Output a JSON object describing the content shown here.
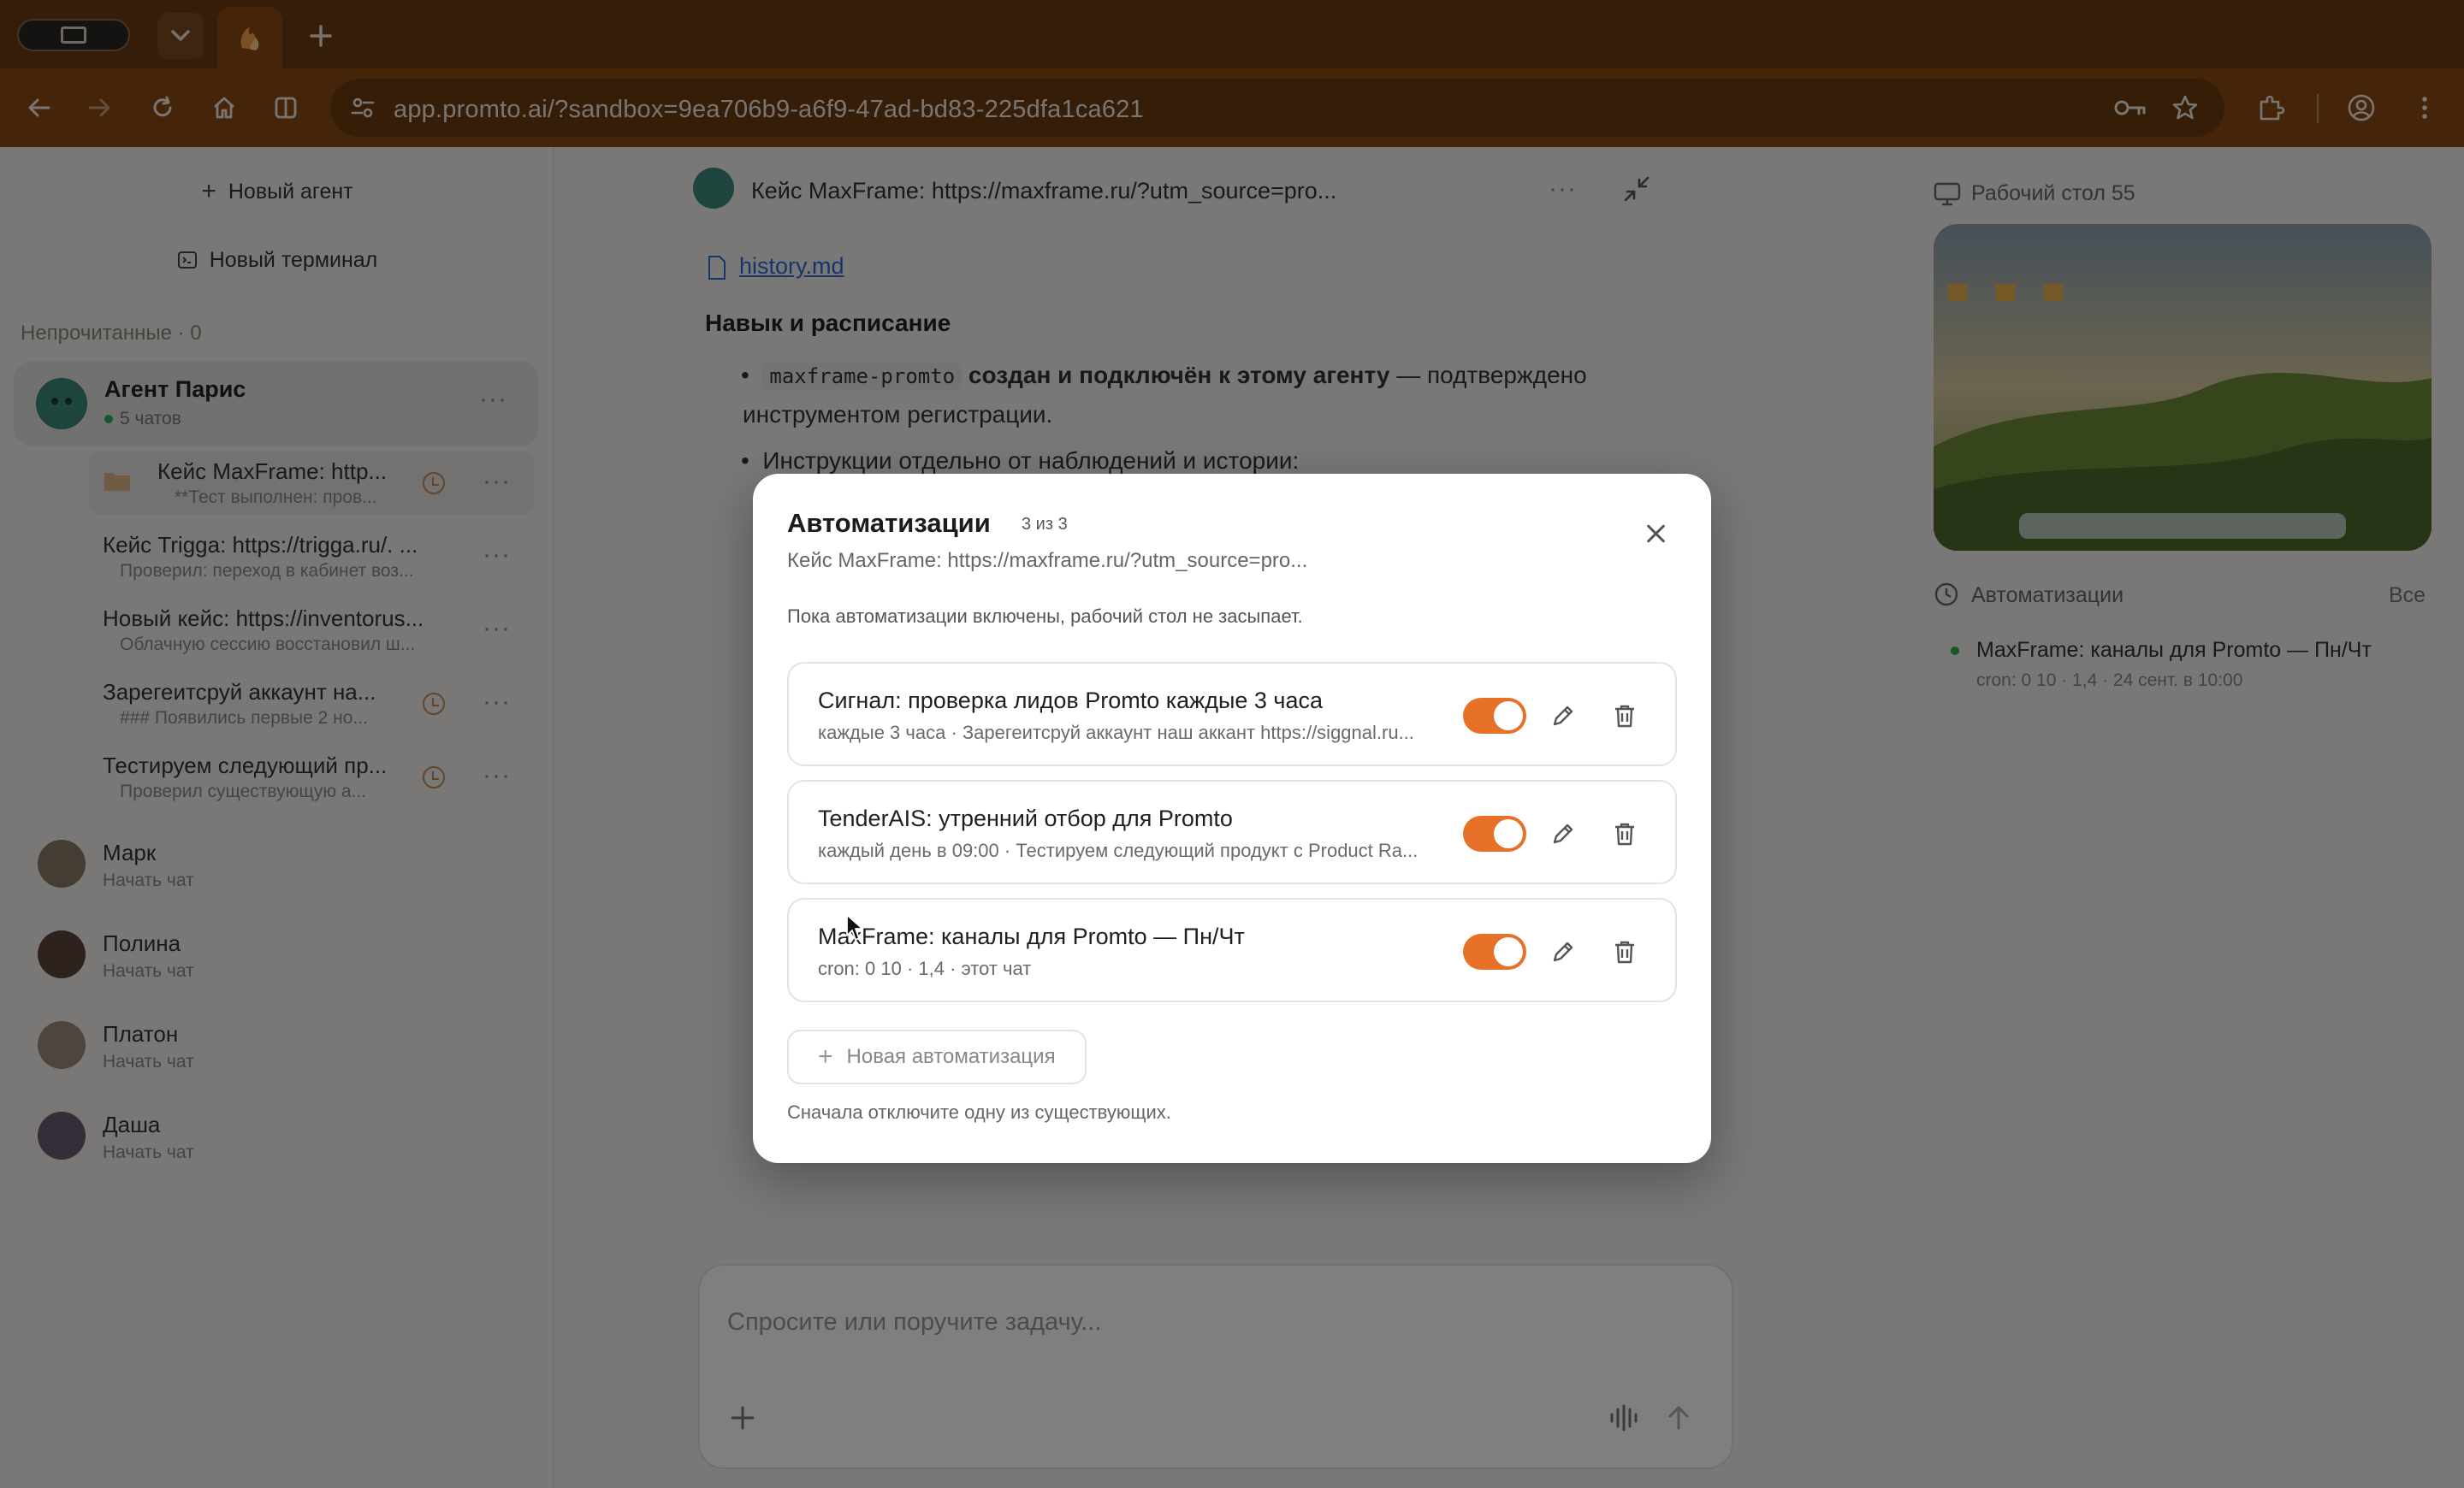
{
  "browser": {
    "url": "app.promto.ai/?sandbox=9ea706b9-a6f9-47ad-bd83-225dfa1ca621"
  },
  "sidebar": {
    "new_agent": "Новый агент",
    "new_terminal": "Новый терминал",
    "section_unread": "Непрочитанные · 0",
    "agent": {
      "name": "Агент Парис",
      "sub": "5 чатов"
    },
    "chats": [
      {
        "title": "Кейс MaxFrame: http...",
        "sub": "**Тест выполнен: пров..."
      },
      {
        "title": "Кейс Trigga: https://trigga.ru/. ...",
        "sub": "Проверил: переход в кабинет воз..."
      },
      {
        "title": "Новый кейс: https://inventorus...",
        "sub": "Облачную сессию восстановил ш..."
      },
      {
        "title": "Зарегеитсруй аккаунт на...",
        "sub": "### Появились первые 2 но..."
      },
      {
        "title": "Тестируем следующий пр...",
        "sub": "Проверил существующую а..."
      }
    ],
    "people": [
      {
        "name": "Марк",
        "sub": "Начать чат"
      },
      {
        "name": "Полина",
        "sub": "Начать чат"
      },
      {
        "name": "Платон",
        "sub": "Начать чат"
      },
      {
        "name": "Даша",
        "sub": "Начать чат"
      }
    ]
  },
  "chat": {
    "title": "Кейс MaxFrame: https://maxframe.ru/?utm_source=pro...",
    "file_link": "history.md",
    "heading": "Навык и расписание",
    "bullet1_code": "maxframe-promto",
    "bullet1_bold": "создан и подключён к этому агенту",
    "bullet1_rest": "— подтверждено",
    "bullet1_line2": "инструментом регистрации.",
    "bullet2": "Инструкции отдельно от наблюдений и истории:",
    "composer_placeholder": "Спросите или поручите задачу..."
  },
  "right_pane": {
    "desktop_title": "Рабочий стол 55",
    "automations_title": "Автоматизации",
    "all_link": "Все",
    "automation_item": "MaxFrame: каналы для Promto — Пн/Чт",
    "automation_item_sub": "cron: 0 10 · 1,4 · 24 сент. в 10:00"
  },
  "modal": {
    "title": "Автоматизации",
    "count": "3 из 3",
    "subtitle": "Кейс MaxFrame: https://maxframe.ru/?utm_source=pro...",
    "note": "Пока автоматизации включены, рабочий стол не засыпает.",
    "automations": [
      {
        "title": "Сигнал: проверка лидов Promto каждые 3 часа",
        "sub": "каждые 3 часа · Зарегеитсруй аккаунт наш аккант https://siggnal.ru...",
        "enabled": true
      },
      {
        "title": "TenderAIS: утренний отбор для Promto",
        "sub": "каждый день в 09:00 · Тестируем следующий продукт с Product Ra...",
        "enabled": true
      },
      {
        "title": "MaxFrame: каналы для Promto — Пн/Чт",
        "sub": "cron: 0 10 · 1,4 · этот чат",
        "enabled": true
      }
    ],
    "new_button": "Новая автоматизация",
    "footer": "Сначала отключите одну из существующих."
  },
  "colors": {
    "accent": "#e8712a",
    "browser_chrome": "#8a4a15"
  }
}
